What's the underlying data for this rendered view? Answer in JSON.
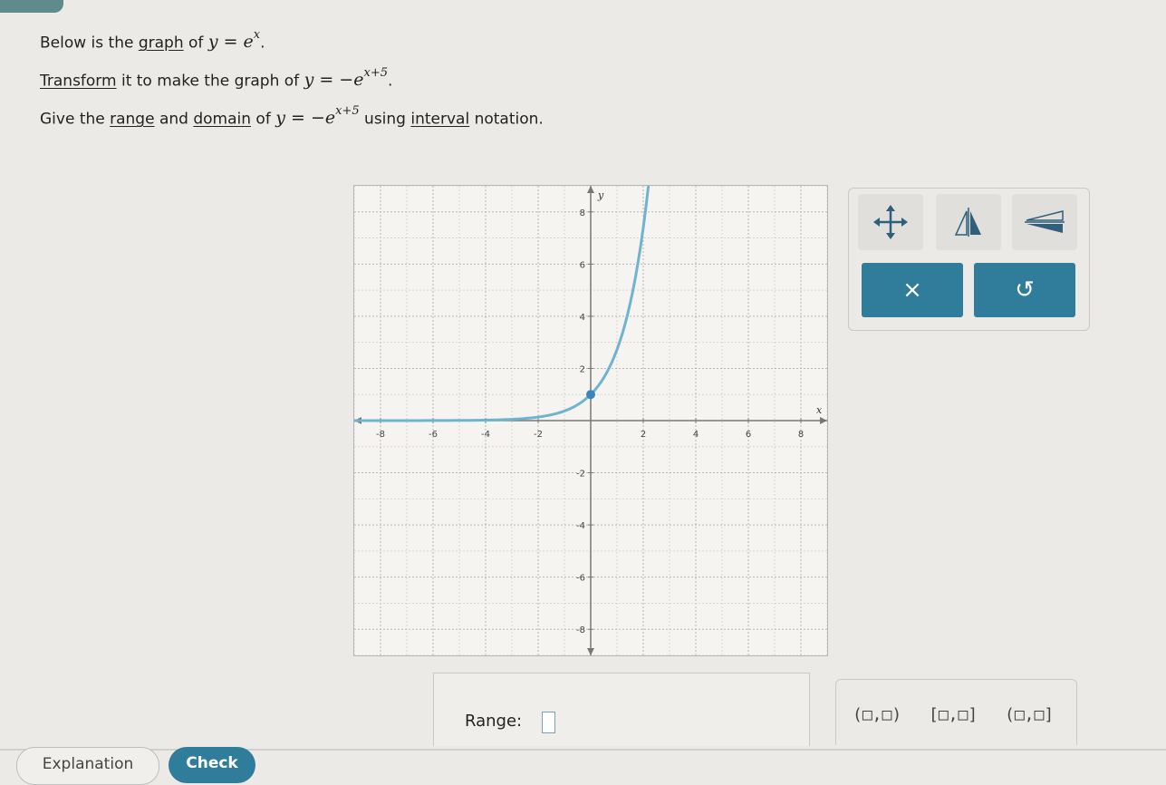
{
  "prompt": {
    "line1": {
      "pre": "Below is the ",
      "link": "graph",
      "post": " of ",
      "eq_lhs": "y",
      "eq_eq": " = ",
      "eq_base": "e",
      "eq_exp": "x",
      "end": "."
    },
    "line2": {
      "link": "Transform",
      "post": " it to make the graph of ",
      "eq_lhs": "y",
      "eq_eq": " = −",
      "eq_base": "e",
      "eq_exp": "x+5",
      "end": "."
    },
    "line3": {
      "pre": "Give the ",
      "link_range": "range",
      "mid": " and ",
      "link_domain": "domain",
      "post": " of ",
      "eq_lhs": "y",
      "eq_eq": " = −",
      "eq_base": "e",
      "eq_exp": "x+5",
      "post2": " using ",
      "link_interval": "interval",
      "end": " notation."
    }
  },
  "graph": {
    "x_label": "x",
    "y_label": "y",
    "x_ticks": [
      "-8",
      "-6",
      "-4",
      "-2",
      "2",
      "4",
      "6",
      "8"
    ],
    "y_ticks": [
      "8",
      "6",
      "4",
      "2",
      "-2",
      "-4",
      "-6",
      "-8"
    ]
  },
  "chart_data": {
    "type": "line",
    "xlabel": "x",
    "ylabel": "y",
    "xlim": [
      -9,
      9
    ],
    "ylim": [
      -9,
      9
    ],
    "grid": true,
    "series": [
      {
        "function": "e^x",
        "x": [
          -9,
          -8,
          -6,
          -4,
          -2,
          -1,
          0,
          1,
          1.5,
          2,
          2.2
        ],
        "y": [
          0.0001,
          0.0003,
          0.0025,
          0.018,
          0.135,
          0.368,
          1,
          2.72,
          4.48,
          7.39,
          9.03
        ]
      }
    ],
    "points": [
      {
        "x": 0,
        "y": 1
      }
    ],
    "colors": {
      "curve": "#6fb3cf",
      "point": "#3a86b8"
    }
  },
  "tools": {
    "move_icon": "move-arrows-icon",
    "reflect_y_icon": "reflect-y-axis-icon",
    "reflect_x_icon": "reflect-x-axis-icon",
    "clear_label": "×",
    "undo_label": "↺"
  },
  "answer": {
    "range_label": "Range:"
  },
  "intervals": {
    "open": "(□,□)",
    "closed": "[□,□]",
    "half_open": "(□,□]"
  },
  "footer": {
    "explanation": "Explanation",
    "check": "Check"
  }
}
